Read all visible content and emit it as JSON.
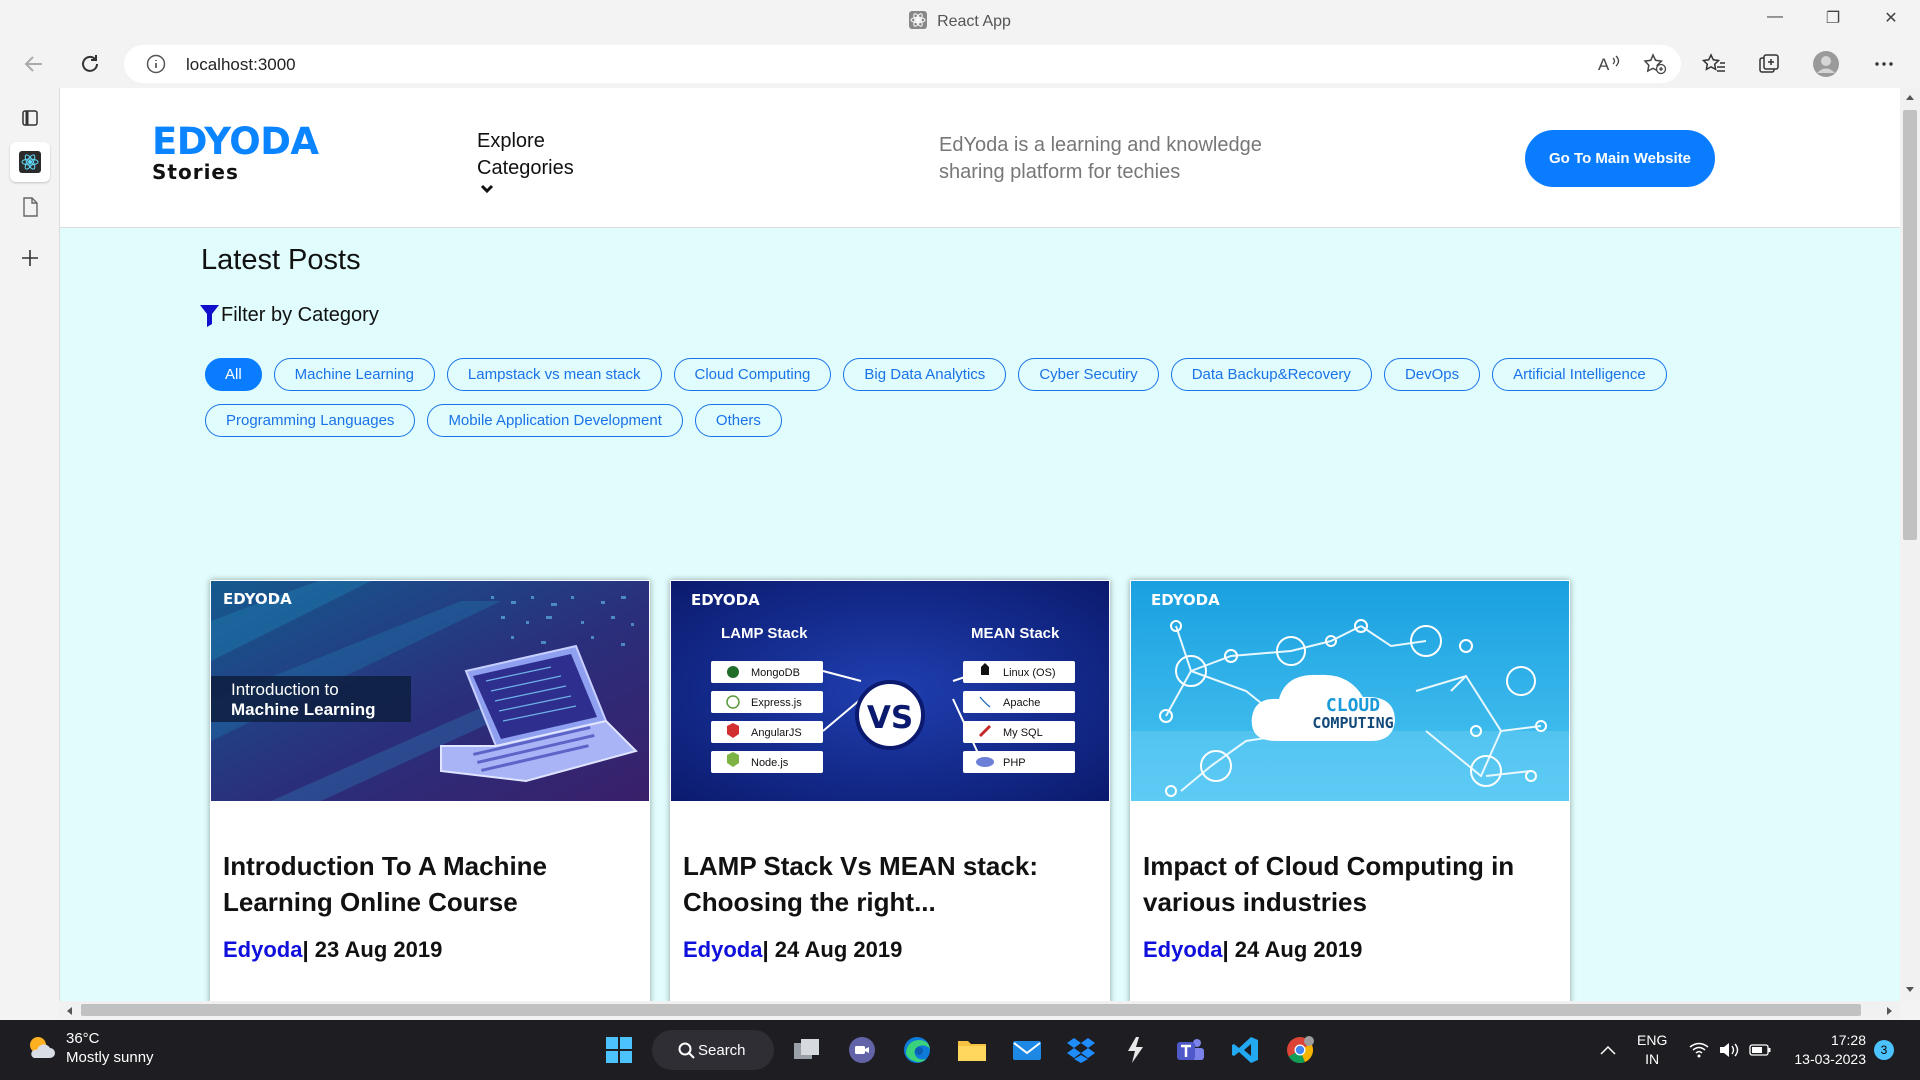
{
  "browser": {
    "window_title": "React App",
    "url": "localhost:3000"
  },
  "site": {
    "brand": "EDYODA",
    "brand_sub": "Stories",
    "explore": "Explore Categories",
    "tagline": "EdYoda is a learning and knowledge sharing platform for techies",
    "main_button": "Go To Main Website",
    "section_title": "Latest Posts",
    "filter_label": "Filter by Category",
    "categories_row1": [
      "All",
      "Machine Learning",
      "Lampstack vs mean stack",
      "Cloud Computing",
      "Big Data Analytics",
      "Cyber Secutiry",
      "Data Backup&Recovery",
      "DevOps",
      "Artificial Intelligence"
    ],
    "categories_row2": [
      "Programming Languages",
      "Mobile Application Development",
      "Others"
    ],
    "active_category": "All",
    "accent": "#0a7cff",
    "page_bg": "#e0fcfc"
  },
  "posts": [
    {
      "title": "Introduction To A Machine Learning Online Course",
      "author": "Edyoda",
      "date": "| 23 Aug 2019",
      "thumb": {
        "logo": "EDYODA",
        "line1": "Introduction to",
        "line2": "Machine Learning"
      }
    },
    {
      "title": "LAMP Stack Vs MEAN stack: Choosing the right...",
      "author": "Edyoda",
      "date": "| 24 Aug 2019",
      "thumb": {
        "logo": "EDYODA",
        "left_head": "LAMP Stack",
        "right_head": "MEAN Stack",
        "vs": "VS",
        "left_items": [
          "MongoDB",
          "Express.js",
          "AngularJS",
          "Node.js"
        ],
        "right_items": [
          "Linux (OS)",
          "Apache",
          "My SQL",
          "PHP"
        ]
      }
    },
    {
      "title": "Impact of Cloud Computing in various industries",
      "author": "Edyoda",
      "date": "| 24 Aug 2019",
      "thumb": {
        "logo": "EDYODA",
        "line1": "CLOUD",
        "line2": "COMPUTING"
      }
    }
  ],
  "taskbar": {
    "temp": "36°C",
    "weather": "Mostly sunny",
    "search": "Search",
    "lang1": "ENG",
    "lang2": "IN",
    "time": "17:28",
    "date": "13-03-2023",
    "notifications": "3"
  }
}
